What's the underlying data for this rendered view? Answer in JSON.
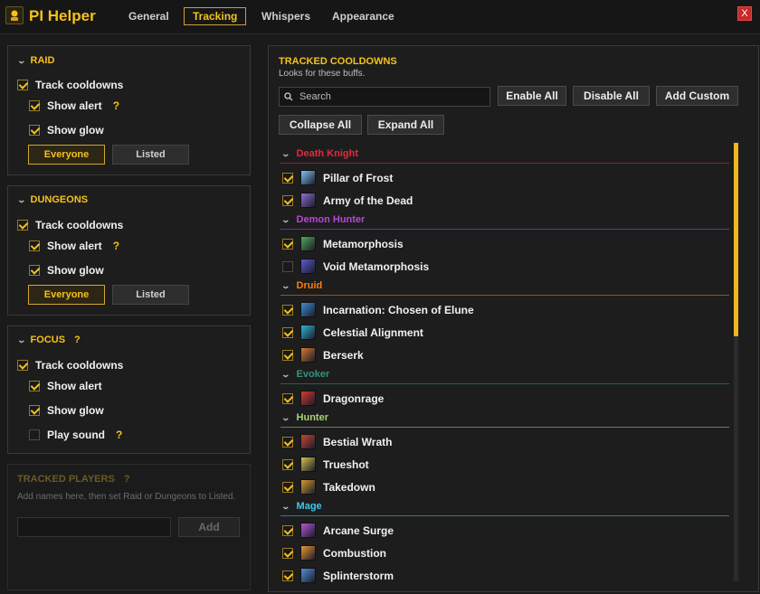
{
  "app": {
    "title": "PI Helper"
  },
  "tabs": [
    {
      "label": "General",
      "active": false
    },
    {
      "label": "Tracking",
      "active": true
    },
    {
      "label": "Whispers",
      "active": false
    },
    {
      "label": "Appearance",
      "active": false
    }
  ],
  "close_label": "X",
  "raid": {
    "title": "RAID",
    "track_cooldowns": {
      "label": "Track cooldowns",
      "checked": true
    },
    "show_alert": {
      "label": "Show alert",
      "checked": true,
      "help": "?"
    },
    "show_glow": {
      "label": "Show glow",
      "checked": true
    },
    "mode": {
      "everyone": "Everyone",
      "listed": "Listed",
      "selected": "Everyone"
    }
  },
  "dungeons": {
    "title": "DUNGEONS",
    "track_cooldowns": {
      "label": "Track cooldowns",
      "checked": true
    },
    "show_alert": {
      "label": "Show alert",
      "checked": true,
      "help": "?"
    },
    "show_glow": {
      "label": "Show glow",
      "checked": true
    },
    "mode": {
      "everyone": "Everyone",
      "listed": "Listed",
      "selected": "Everyone"
    }
  },
  "focus": {
    "title": "FOCUS",
    "help": "?",
    "track_cooldowns": {
      "label": "Track cooldowns",
      "checked": true
    },
    "show_alert": {
      "label": "Show alert",
      "checked": true
    },
    "show_glow": {
      "label": "Show glow",
      "checked": true
    },
    "play_sound": {
      "label": "Play sound",
      "checked": false,
      "help": "?"
    }
  },
  "tracked_players": {
    "title": "TRACKED PLAYERS",
    "help": "?",
    "hint": "Add names here, then set Raid or Dungeons to Listed.",
    "input_value": "",
    "add_label": "Add"
  },
  "cooldowns": {
    "title": "TRACKED COOLDOWNS",
    "subtitle": "Looks for these buffs.",
    "search_placeholder": "Search",
    "enable_all": "Enable All",
    "disable_all": "Disable All",
    "add_custom": "Add Custom",
    "collapse_all": "Collapse All",
    "expand_all": "Expand All",
    "groups": [
      {
        "name": "Death Knight",
        "color": "#e8273c",
        "spells": [
          {
            "name": "Pillar of Frost",
            "checked": true,
            "icon": "frost-icon",
            "icon_color": "#7fc4f0"
          },
          {
            "name": "Army of the Dead",
            "checked": true,
            "icon": "undead-icon",
            "icon_color": "#8b6fd1"
          }
        ]
      },
      {
        "name": "Demon Hunter",
        "color": "#b547d6",
        "spells": [
          {
            "name": "Metamorphosis",
            "checked": true,
            "icon": "demon-icon",
            "icon_color": "#4fa85a"
          },
          {
            "name": "Void Metamorphosis",
            "checked": false,
            "icon": "void-icon",
            "icon_color": "#5a5ad6"
          }
        ]
      },
      {
        "name": "Druid",
        "color": "#ff7d0a",
        "spells": [
          {
            "name": "Incarnation: Chosen of Elune",
            "checked": true,
            "icon": "moon-icon",
            "icon_color": "#3c8fd6"
          },
          {
            "name": "Celestial Alignment",
            "checked": true,
            "icon": "star-icon",
            "icon_color": "#2fb3d6"
          },
          {
            "name": "Berserk",
            "checked": true,
            "icon": "claw-icon",
            "icon_color": "#d6782f"
          }
        ]
      },
      {
        "name": "Evoker",
        "color": "#33937f",
        "spells": [
          {
            "name": "Dragonrage",
            "checked": true,
            "icon": "dragon-icon",
            "icon_color": "#d63a2f"
          }
        ]
      },
      {
        "name": "Hunter",
        "color": "#a9d271",
        "spells": [
          {
            "name": "Bestial Wrath",
            "checked": true,
            "icon": "beast-icon",
            "icon_color": "#c9452f"
          },
          {
            "name": "Trueshot",
            "checked": true,
            "icon": "arrow-icon",
            "icon_color": "#d6c24f"
          },
          {
            "name": "Takedown",
            "checked": true,
            "icon": "takedown-icon",
            "icon_color": "#d69a2f"
          }
        ]
      },
      {
        "name": "Mage",
        "color": "#3fc7eb",
        "spells": [
          {
            "name": "Arcane Surge",
            "checked": true,
            "icon": "arcane-icon",
            "icon_color": "#b05ad6"
          },
          {
            "name": "Combustion",
            "checked": true,
            "icon": "fire-icon",
            "icon_color": "#e8962f"
          },
          {
            "name": "Splinterstorm",
            "checked": true,
            "icon": "storm-icon",
            "icon_color": "#4f8fd6"
          }
        ]
      }
    ]
  },
  "accent": "#f5c21b"
}
